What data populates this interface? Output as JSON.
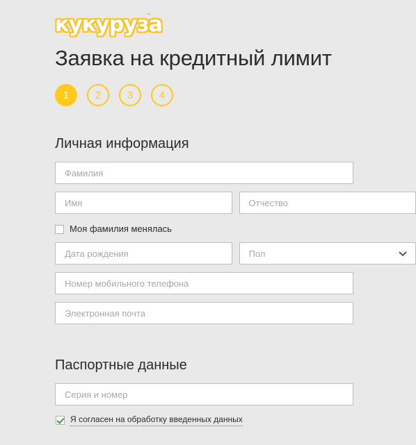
{
  "brand": {
    "logo_text": "кукуруза",
    "trademark": "™"
  },
  "page": {
    "title": "Заявка на кредитный лимит"
  },
  "steps": {
    "active_step": "1",
    "items": [
      {
        "label": "1",
        "state": "active"
      },
      {
        "label": "2",
        "state": "inactive"
      },
      {
        "label": "3",
        "state": "inactive"
      },
      {
        "label": "4",
        "state": "inactive"
      }
    ],
    "accent_color": "#ffc91e"
  },
  "sections": {
    "personal": {
      "heading": "Личная информация",
      "fields": {
        "lastname": {
          "placeholder": "Фамилия",
          "value": ""
        },
        "firstname": {
          "placeholder": "Имя",
          "value": ""
        },
        "middlename": {
          "placeholder": "Отчество",
          "value": ""
        },
        "birthdate": {
          "placeholder": "Дата рождения",
          "value": ""
        },
        "gender": {
          "placeholder": "Пол",
          "value": "",
          "icon": "chevron-down-icon"
        },
        "phone": {
          "placeholder": "Номер мобильного телефона",
          "value": ""
        },
        "email": {
          "placeholder": "Электронная почта",
          "value": ""
        }
      },
      "name_changed": {
        "label": "Моя фамилия менялась",
        "checked": false
      }
    },
    "passport": {
      "heading": "Паспортные данные",
      "fields": {
        "series_number": {
          "placeholder": "Серия и номер",
          "value": ""
        }
      }
    }
  },
  "consent": {
    "label": "Я согласен на обработку введенных данных",
    "checked": true,
    "check_color": "#3a9a3a"
  },
  "colors": {
    "background": "#e9e9e9",
    "input_background": "#ffffff",
    "input_border": "#bdbdbd",
    "placeholder": "#a8a8a8",
    "text": "#2b2b2b",
    "accent": "#ffc91e"
  }
}
